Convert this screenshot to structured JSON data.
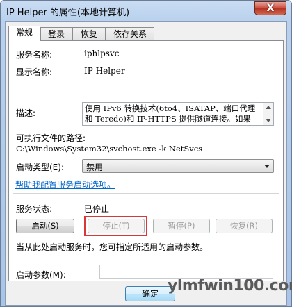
{
  "window": {
    "title": "IP Helper 的属性(本地计算机)",
    "close_label": "X"
  },
  "tabs": [
    {
      "label": "常规",
      "active": true
    },
    {
      "label": "登录",
      "active": false
    },
    {
      "label": "恢复",
      "active": false
    },
    {
      "label": "依存关系",
      "active": false
    }
  ],
  "general": {
    "service_name_label": "服务名称:",
    "service_name_value": "iphlpsvc",
    "display_name_label": "显示名称:",
    "display_name_value": "IP Helper",
    "description_label": "描述:",
    "description_value": "使用 IPv6 转换技术(6to4、ISATAP、端口代理和 Teredo)和 IP-HTTPS 提供隧道连接。如果",
    "exe_path_label": "可执行文件的路径:",
    "exe_path_value": "C:\\Windows\\System32\\svchost.exe -k NetSvcs",
    "startup_type_label": "启动类型(E):",
    "startup_type_value": "禁用",
    "help_link": "帮助我配置服务启动选项。",
    "status_label": "服务状态:",
    "status_value": "已停止",
    "buttons": {
      "start": "启动(S)",
      "stop": "停止(T)",
      "pause": "暂停(P)",
      "resume": "恢复(R)"
    },
    "hint_text": "当从此处启动服务时，您可指定所适用的启动参数。",
    "start_params_label": "启动参数(M):",
    "start_params_value": ""
  },
  "footer": {
    "ok_label": "确定"
  },
  "watermark": "ylmfwin100.com",
  "colors": {
    "highlight": "#d9383a",
    "link": "#0066cc"
  }
}
